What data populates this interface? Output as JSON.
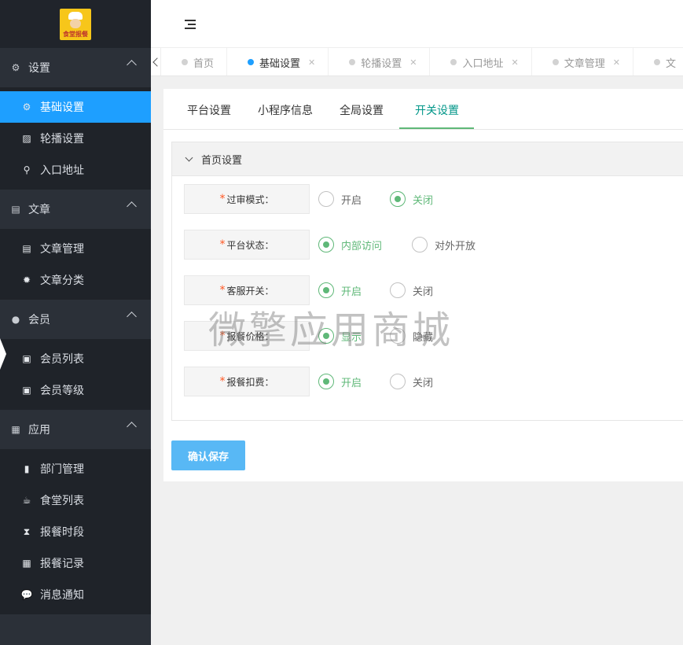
{
  "logo": {
    "text": "食堂报餐"
  },
  "sidebar": {
    "groups": [
      {
        "label": "设置",
        "icon": "gears-icon",
        "items": [
          {
            "label": "基础设置",
            "icon": "gear-icon",
            "active": true
          },
          {
            "label": "轮播设置",
            "icon": "image-icon"
          },
          {
            "label": "入口地址",
            "icon": "search-icon"
          }
        ]
      },
      {
        "label": "文章",
        "icon": "newspaper-icon",
        "items": [
          {
            "label": "文章管理",
            "icon": "newspaper-icon"
          },
          {
            "label": "文章分类",
            "icon": "gear-icon"
          }
        ]
      },
      {
        "label": "会员",
        "icon": "user-icon",
        "items": [
          {
            "label": "会员列表",
            "icon": "contact-book-icon"
          },
          {
            "label": "会员等级",
            "icon": "contact-book-icon"
          }
        ]
      },
      {
        "label": "应用",
        "icon": "grid-icon",
        "items": [
          {
            "label": "部门管理",
            "icon": "list-icon"
          },
          {
            "label": "食堂列表",
            "icon": "cup-icon"
          },
          {
            "label": "报餐时段",
            "icon": "hourglass-icon"
          },
          {
            "label": "报餐记录",
            "icon": "table-icon"
          },
          {
            "label": "消息通知",
            "icon": "chat-icon"
          }
        ]
      }
    ]
  },
  "tabs": [
    {
      "label": "首页",
      "active": false,
      "closable": false
    },
    {
      "label": "基础设置",
      "active": true,
      "closable": true
    },
    {
      "label": "轮播设置",
      "active": false,
      "closable": true
    },
    {
      "label": "入口地址",
      "active": false,
      "closable": true
    },
    {
      "label": "文章管理",
      "active": false,
      "closable": true
    },
    {
      "label": "文",
      "active": false,
      "closable": true
    }
  ],
  "subtabs": [
    "平台设置",
    "小程序信息",
    "全局设置",
    "开关设置"
  ],
  "active_subtab": "开关设置",
  "section": {
    "title": "首页设置"
  },
  "form": [
    {
      "label": "过审模式：",
      "options": [
        "开启",
        "关闭"
      ],
      "selected": "关闭"
    },
    {
      "label": "平台状态：",
      "options": [
        "内部访问",
        "对外开放"
      ],
      "selected": "内部访问"
    },
    {
      "label": "客服开关：",
      "options": [
        "开启",
        "关闭"
      ],
      "selected": "开启"
    },
    {
      "label": "报餐价格：",
      "options": [
        "显示",
        "隐藏"
      ],
      "selected": "显示"
    },
    {
      "label": "报餐扣费：",
      "options": [
        "开启",
        "关闭"
      ],
      "selected": "开启"
    }
  ],
  "save_button": "确认保存",
  "watermark": "微擎应用商城",
  "colors": {
    "accent": "#1e9fff",
    "success": "#5fb878",
    "sidebar": "#2b3038",
    "required": "#ff5722"
  }
}
